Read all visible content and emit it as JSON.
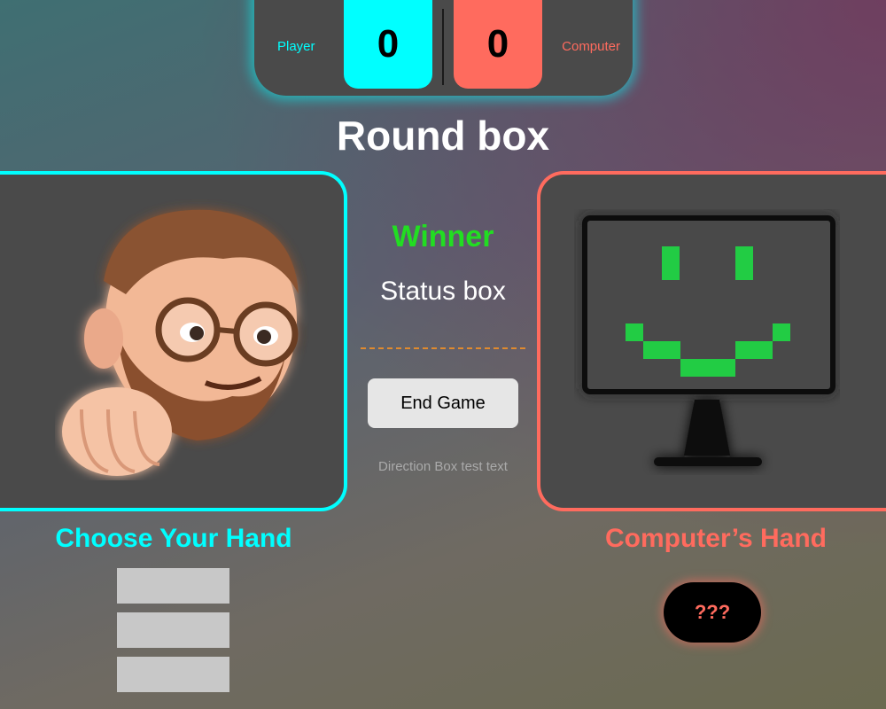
{
  "scoreboard": {
    "player_label": "Player",
    "computer_label": "Computer",
    "player_score": "0",
    "computer_score": "0"
  },
  "round_text": "Round box",
  "center": {
    "winner_text": "Winner",
    "status_text": "Status box",
    "end_game_label": "End Game",
    "direction_text": "Direction Box test text"
  },
  "player_panel": {
    "title": "Choose Your Hand",
    "avatar_icon": "memoji-fist-avatar",
    "choices": [
      "",
      "",
      ""
    ]
  },
  "computer_panel": {
    "title": "Computer’s Hand",
    "avatar_icon": "smiley-monitor-icon",
    "choice_text": "???"
  },
  "colors": {
    "player_accent": "#00ffff",
    "computer_accent": "#ff6b5e",
    "winner": "#22dd22",
    "panel_bg": "#4a4a4a"
  }
}
